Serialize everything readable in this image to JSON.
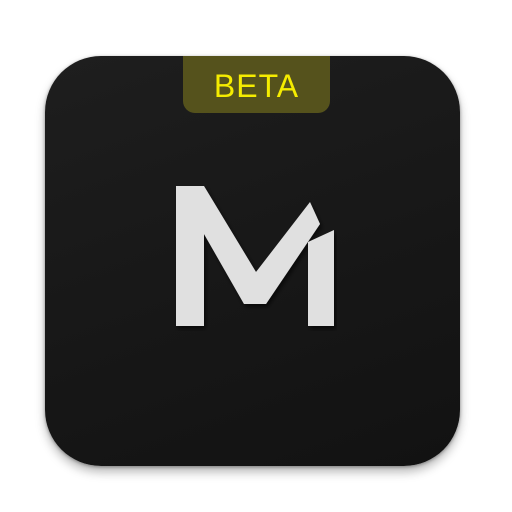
{
  "icon": {
    "badge_label": "BETA",
    "logo_glyph": "M",
    "colors": {
      "tile": "#171717",
      "badge_background": "#55521c",
      "badge_text": "#f5ec00",
      "logo": "#e0e0e0"
    }
  }
}
